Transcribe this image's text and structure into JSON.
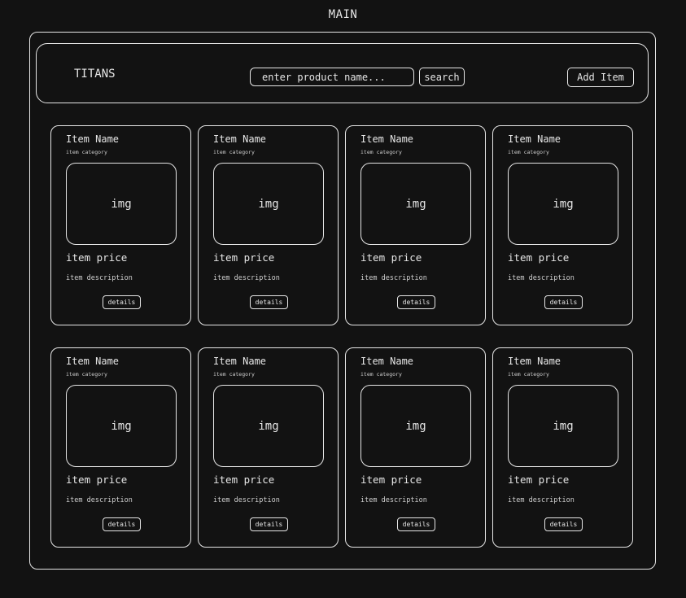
{
  "frame": {
    "title": "MAIN"
  },
  "header": {
    "brand": "TITANS",
    "search_placeholder": "enter product name...",
    "search_button": "search",
    "add_button": "Add Item"
  },
  "products": [
    {
      "name": "Item Name",
      "category": "item category",
      "image": "img",
      "price": "item price",
      "description": "item description",
      "details": "details"
    },
    {
      "name": "Item Name",
      "category": "item category",
      "image": "img",
      "price": "item price",
      "description": "item description",
      "details": "details"
    },
    {
      "name": "Item Name",
      "category": "item category",
      "image": "img",
      "price": "item price",
      "description": "item description",
      "details": "details"
    },
    {
      "name": "Item Name",
      "category": "item category",
      "image": "img",
      "price": "item price",
      "description": "item description",
      "details": "details"
    },
    {
      "name": "Item Name",
      "category": "item category",
      "image": "img",
      "price": "item price",
      "description": "item description",
      "details": "details"
    },
    {
      "name": "Item Name",
      "category": "item category",
      "image": "img",
      "price": "item price",
      "description": "item description",
      "details": "details"
    },
    {
      "name": "Item Name",
      "category": "item category",
      "image": "img",
      "price": "item price",
      "description": "item description",
      "details": "details"
    },
    {
      "name": "Item Name",
      "category": "item category",
      "image": "img",
      "price": "item price",
      "description": "item description",
      "details": "details"
    }
  ]
}
